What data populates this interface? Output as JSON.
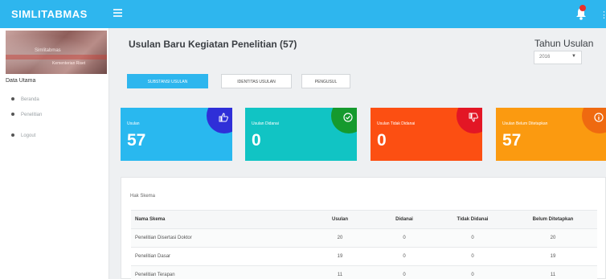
{
  "topbar": {
    "brand": "SIMLITABMAS"
  },
  "sidebar": {
    "heading": "Data Utama",
    "banner_label": "Simlitabmas",
    "banner_caption": "Kementerian Riset",
    "items": [
      {
        "label": "Beranda"
      },
      {
        "label": "Penelitian"
      },
      {
        "label": "Logout"
      }
    ]
  },
  "header": {
    "title": "Usulan Baru Kegiatan Penelitian (57)",
    "year_label": "Tahun Usulan",
    "year_value": "2016"
  },
  "actions": [
    {
      "label": "SUBSTANSI USULAN"
    },
    {
      "label": "IDENTITAS USULAN"
    },
    {
      "label": "PENGUSUL"
    }
  ],
  "cards": [
    {
      "label": "Usulan",
      "value": "57",
      "color": "#29b8ef",
      "corner": "#2f2fd8",
      "icon": "thumbs-up-icon"
    },
    {
      "label": "Usulan Didanai",
      "value": "0",
      "color": "#11c4c4",
      "corner": "#159a2e",
      "icon": "check-circle-icon"
    },
    {
      "label": "Usulan Tidak Didanai",
      "value": "0",
      "color": "#fc4f12",
      "corner": "#e31625",
      "icon": "thumbs-down-icon"
    },
    {
      "label": "Usulan Belum Ditetapkan",
      "value": "57",
      "color": "#fb9a10",
      "corner": "#ef6a10",
      "icon": "info-icon"
    }
  ],
  "table": {
    "title": "Hak Skema",
    "columns": [
      "Nama Skema",
      "Usulan",
      "Didanai",
      "Tidak Didanai",
      "Belum Ditetapkan"
    ],
    "rows": [
      [
        "Penelitian Disertasi Doktor",
        "20",
        "0",
        "0",
        "20"
      ],
      [
        "Penelitian Dasar",
        "19",
        "0",
        "0",
        "19"
      ],
      [
        "Penelitian Terapan",
        "11",
        "0",
        "0",
        "11"
      ]
    ]
  }
}
